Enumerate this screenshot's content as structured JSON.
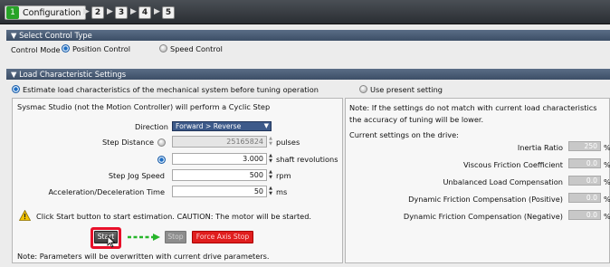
{
  "wizard": {
    "step1_num": "1",
    "step1_label": "Configuration",
    "steps": [
      "2",
      "3",
      "4",
      "5"
    ]
  },
  "control_type": {
    "header": "▼ Select Control Type",
    "mode_label": "Control Mode",
    "option1": "Position Control",
    "option2": "Speed Control"
  },
  "load": {
    "header": "▼ Load Characteristic Settings",
    "option_estimate": "Estimate load characteristics of the mechanical system before tuning operation",
    "option_present": "Use present setting"
  },
  "left": {
    "info": "Sysmac Studio (not the Motion Controller) will perform a Cyclic Step",
    "direction_label": "Direction",
    "direction_value": "Forward > Reverse",
    "step_distance_label": "Step Distance",
    "step_distance_value": "25165824",
    "step_distance_unit": "pulses",
    "revolutions_value": "3.000",
    "revolutions_unit": "shaft revolutions",
    "jog_speed_label": "Step Jog Speed",
    "jog_speed_value": "500",
    "jog_speed_unit": "rpm",
    "accel_label": "Acceleration/Deceleration Time",
    "accel_value": "50",
    "accel_unit": "ms",
    "warning": "Click Start button to start estimation. CAUTION: The motor will be started.",
    "start_label": "Start",
    "stop_label": "Stop",
    "force_stop_label": "Force Axis Stop",
    "note": "Note: Parameters will be overwritten with current drive parameters."
  },
  "right": {
    "note_line1": "Note: If the settings do not match with current load characteristics",
    "note_line2": "the accuracy of tuning will be lower.",
    "current_label": "Current settings on the drive:",
    "rows": [
      {
        "label": "Inertia Ratio",
        "value": "250",
        "unit": "%"
      },
      {
        "label": "Viscous Friction Coefficient",
        "value": "0.0",
        "unit": "%"
      },
      {
        "label": "Unbalanced Load Compensation",
        "value": "0.0",
        "unit": "%"
      },
      {
        "label": "Dynamic Friction Compensation (Positive)",
        "value": "0.0",
        "unit": "%"
      },
      {
        "label": "Dynamic Friction Compensation (Negative)",
        "value": "0.0",
        "unit": "%"
      }
    ]
  },
  "colors": {
    "header_bar": "#3c4e66",
    "green_step": "#27a327",
    "force_stop": "#e01e1e",
    "dropdown": "#3d5a8a",
    "highlight": "#e8102a"
  }
}
